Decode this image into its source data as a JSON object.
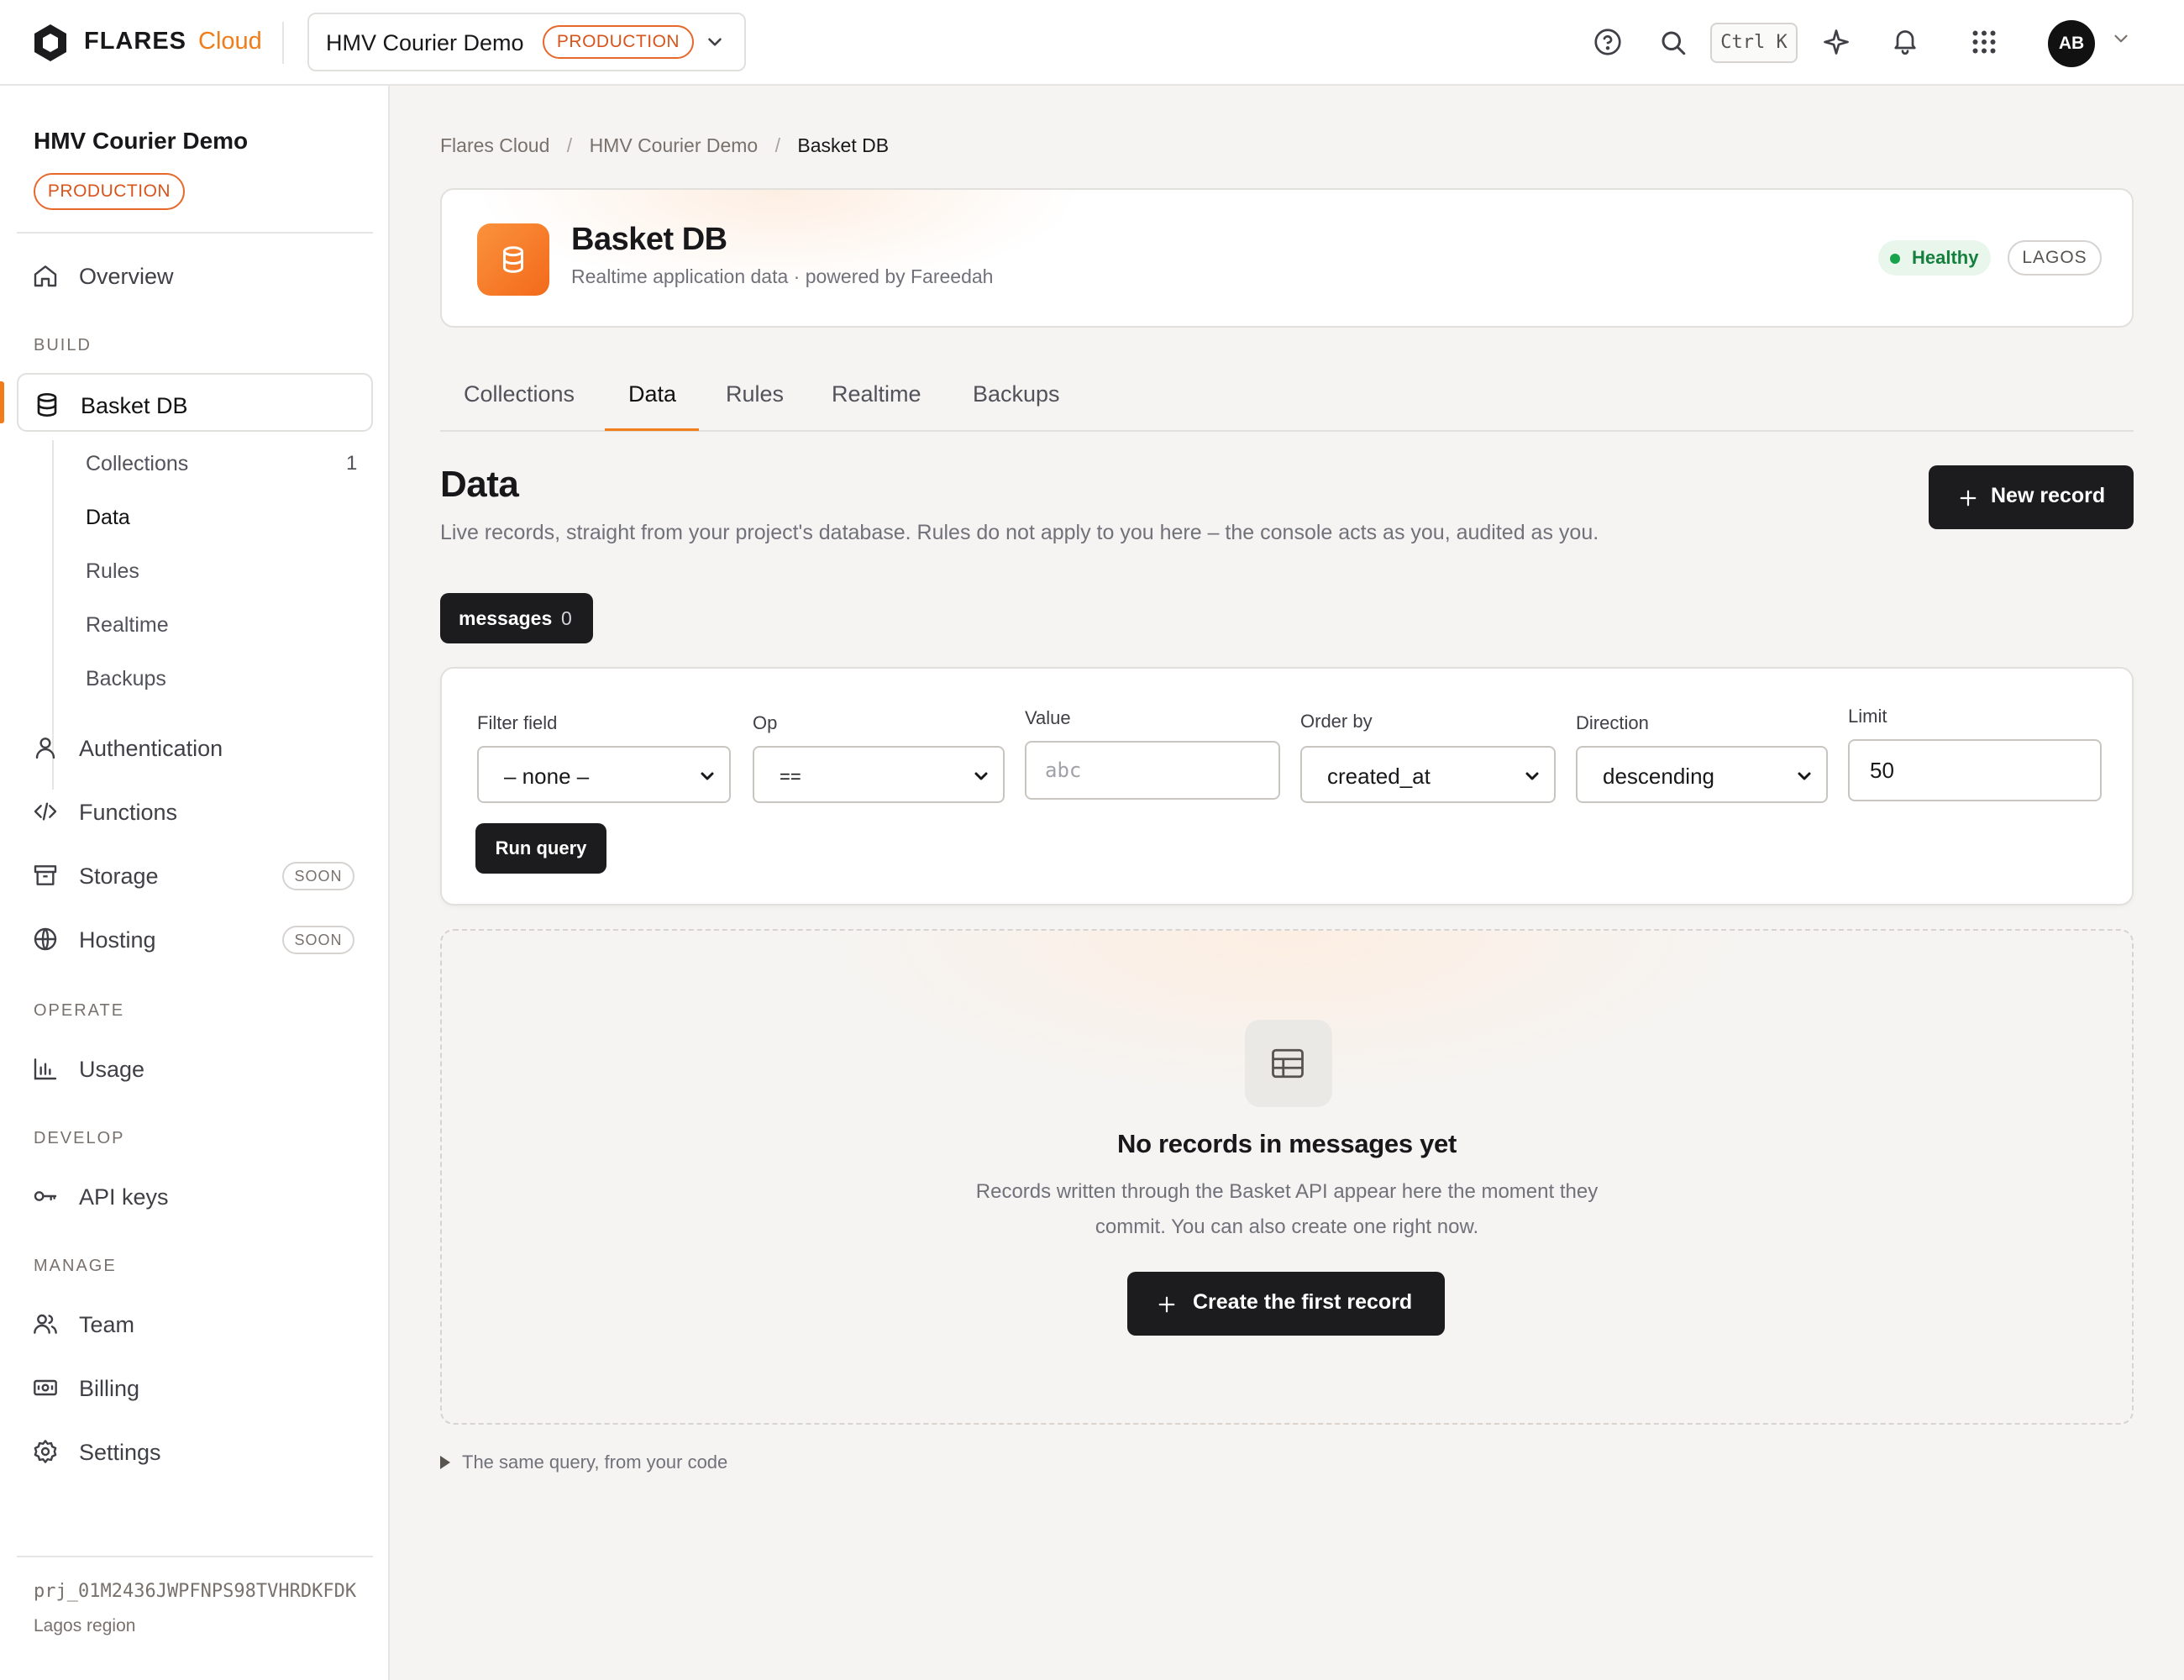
{
  "topbar": {
    "brand": "FLARES",
    "brand_suffix": "Cloud",
    "project_name": "HMV Courier Demo",
    "env_badge": "PRODUCTION",
    "shortcut": "Ctrl K",
    "avatar_initials": "AB",
    "icons": [
      "help-icon",
      "search-icon",
      "sparkle-icon",
      "bell-icon",
      "apps-grid-icon",
      "chevron-down-icon"
    ]
  },
  "sidebar": {
    "project_title": "HMV Courier Demo",
    "env_badge": "PRODUCTION",
    "overview": "Overview",
    "sections": {
      "build": "BUILD",
      "operate": "OPERATE",
      "develop": "DEVELOP",
      "manage": "MANAGE"
    },
    "basket_db": "Basket DB",
    "sub_items": [
      {
        "label": "Collections",
        "count": "1"
      },
      {
        "label": "Data"
      },
      {
        "label": "Rules"
      },
      {
        "label": "Realtime"
      },
      {
        "label": "Backups"
      }
    ],
    "authentication": "Authentication",
    "functions": "Functions",
    "storage": "Storage",
    "hosting": "Hosting",
    "soon_badge": "SOON",
    "usage": "Usage",
    "api_keys": "API keys",
    "team": "Team",
    "billing": "Billing",
    "settings": "Settings",
    "project_id": "prj_01M2436JWPFNPS98TVHRDKFDK",
    "region": "Lagos region"
  },
  "breadcrumb": [
    "Flares Cloud",
    "HMV Courier Demo",
    "Basket DB"
  ],
  "breadcrumb_sep": "/",
  "db_card": {
    "name": "Basket DB",
    "description": "Realtime application data · powered by Fareedah",
    "status": "Healthy",
    "region": "LAGOS",
    "accent_color": "#f26a1b",
    "status_color": "#16a34a"
  },
  "tabs": [
    "Collections",
    "Data",
    "Rules",
    "Realtime",
    "Backups"
  ],
  "active_tab": "Data",
  "page": {
    "title": "Data",
    "subtitle": "Live records, straight from your project's database. Rules do not apply to you here – the console acts as you, audited as you.",
    "new_record_label": "New record"
  },
  "collection_chip": {
    "name": "messages",
    "count": "0"
  },
  "query": {
    "filter_field_label": "Filter field",
    "filter_field_value": "– none –",
    "op_label": "Op",
    "op_value": "==",
    "value_label": "Value",
    "value_placeholder": "abc",
    "order_by_label": "Order by",
    "order_by_value": "created_at",
    "direction_label": "Direction",
    "direction_value": "descending",
    "limit_label": "Limit",
    "limit_value": "50",
    "run_label": "Run query"
  },
  "empty_state": {
    "title": "No records in messages yet",
    "line1": "Records written through the Basket API appear here the moment they",
    "line2": "commit. You can also create one right now.",
    "button_label": "Create the first record"
  },
  "code_toggle": "The same query, from your code"
}
